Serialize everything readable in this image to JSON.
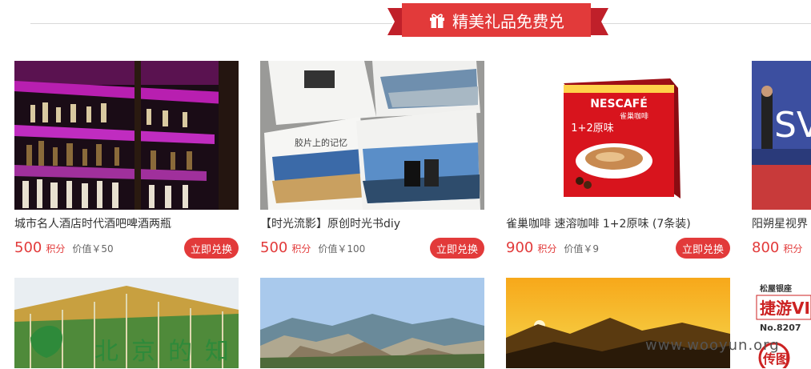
{
  "header": {
    "title": "精美礼品免费兑",
    "icon": "gift-icon",
    "accent": "#e23a3a"
  },
  "row1": [
    {
      "title": "城市名人酒店时代酒吧啤酒两瓶",
      "points": "500",
      "points_unit": "积分",
      "worth": "价值￥50",
      "button": "立即兑换",
      "image": "bar-shelves-photo"
    },
    {
      "title": "【时光流影】原创时光书diy",
      "points": "500",
      "points_unit": "积分",
      "worth": "价值￥100",
      "button": "立即兑换",
      "image": "photo-books-photo",
      "image_text": "胶片上的记忆"
    },
    {
      "title": "雀巢咖啡 速溶咖啡 1+2原味 (7条装)",
      "points": "900",
      "points_unit": "积分",
      "worth": "价值￥9",
      "button": "立即兑换",
      "image": "nescafe-box-photo",
      "image_text": {
        "brand": "NESCAFÉ",
        "cn": "雀巢咖啡",
        "flavor": "1+2原味"
      }
    },
    {
      "title": "阳朔星视界",
      "points": "800",
      "points_unit": "积分",
      "image": "stage-performer-photo"
    }
  ],
  "row2": [
    {
      "image": "beijing-greenhouse-photo",
      "image_text": "北京的知"
    },
    {
      "image": "mountain-cliffs-photo"
    },
    {
      "image": "sunset-mountains-photo"
    },
    {
      "image": "ticket-card-photo",
      "image_text": {
        "top": "松屋银座",
        "main": "捷游VI",
        "no": "No.8207",
        "stamp": "传图"
      }
    }
  ],
  "watermark": "www.wooyun.org"
}
